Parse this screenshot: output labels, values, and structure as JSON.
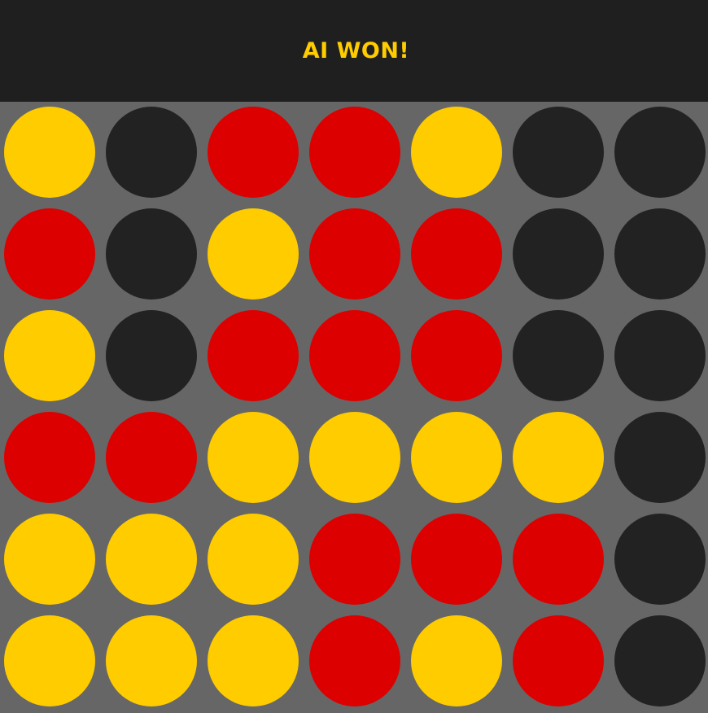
{
  "status": {
    "text": "AI WON!",
    "color": "#ffcc00"
  },
  "colors": {
    "header_bg": "#1f1f1f",
    "board_bg": "#666666",
    "empty": "#222222",
    "red": "#dd0000",
    "yellow": "#ffcc00"
  },
  "board": {
    "rows": 6,
    "columns": 7,
    "grid": [
      [
        "yellow",
        "empty",
        "red",
        "red",
        "yellow",
        "empty",
        "empty"
      ],
      [
        "red",
        "empty",
        "yellow",
        "red",
        "red",
        "empty",
        "empty"
      ],
      [
        "yellow",
        "empty",
        "red",
        "red",
        "red",
        "empty",
        "empty"
      ],
      [
        "red",
        "red",
        "yellow",
        "yellow",
        "yellow",
        "yellow",
        "empty"
      ],
      [
        "yellow",
        "yellow",
        "yellow",
        "red",
        "red",
        "red",
        "empty"
      ],
      [
        "yellow",
        "yellow",
        "yellow",
        "red",
        "yellow",
        "red",
        "empty"
      ]
    ]
  }
}
